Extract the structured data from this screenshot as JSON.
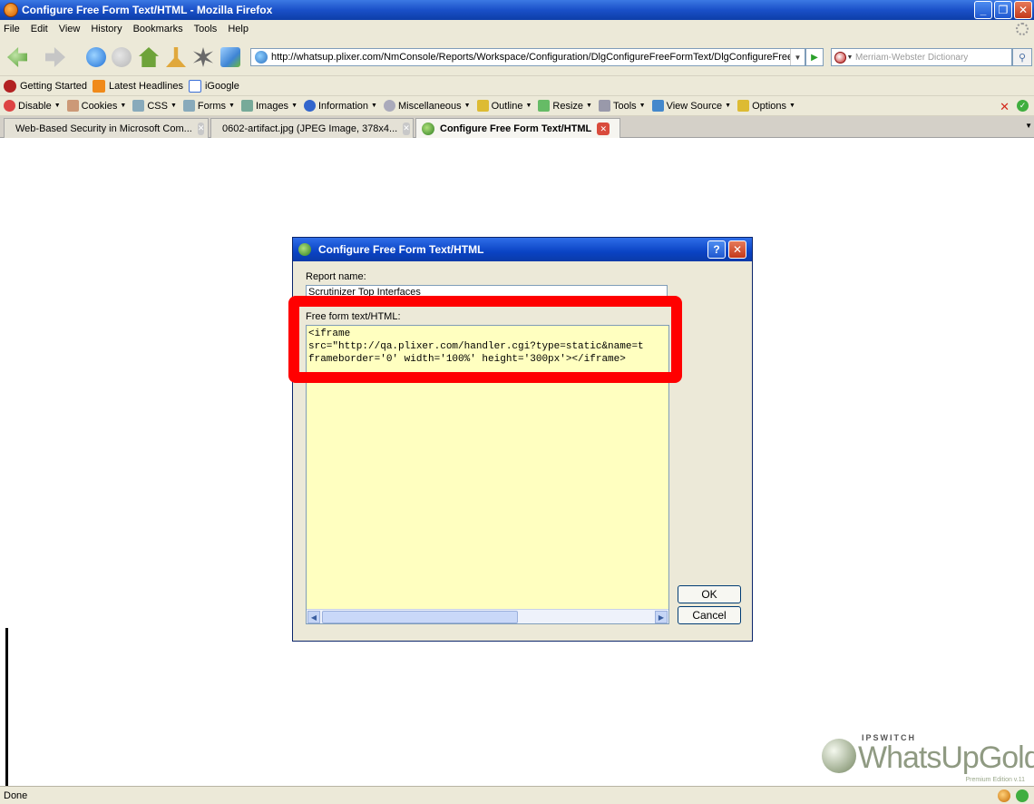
{
  "window": {
    "title": "Configure Free Form Text/HTML - Mozilla Firefox",
    "min": "_",
    "max": "❐",
    "close": "✕"
  },
  "menu": [
    "File",
    "Edit",
    "View",
    "History",
    "Bookmarks",
    "Tools",
    "Help"
  ],
  "nav": {
    "url": "http://whatsup.plixer.com/NmConsole/Reports/Workspace/Configuration/DlgConfigureFreeFormText/DlgConfigureFreeFormText.asp:",
    "search_placeholder": "Merriam-Webster Dictionary"
  },
  "bookmarks": [
    {
      "label": "Getting Started",
      "color": "#b22222"
    },
    {
      "label": "Latest Headlines",
      "color": "#f08a1a"
    },
    {
      "label": "iGoogle",
      "color": "#3b6fd8"
    }
  ],
  "devbar": [
    {
      "label": "Disable",
      "color": "#d44"
    },
    {
      "label": "Cookies",
      "color": "#c97"
    },
    {
      "label": "CSS",
      "color": "#8ab"
    },
    {
      "label": "Forms",
      "color": "#8ab"
    },
    {
      "label": "Images",
      "color": "#7a9"
    },
    {
      "label": "Information",
      "color": "#36c"
    },
    {
      "label": "Miscellaneous",
      "color": "#aab"
    },
    {
      "label": "Outline",
      "color": "#db3"
    },
    {
      "label": "Resize",
      "color": "#6b6"
    },
    {
      "label": "Tools",
      "color": "#99a"
    },
    {
      "label": "View Source",
      "color": "#48c"
    },
    {
      "label": "Options",
      "color": "#db3"
    }
  ],
  "tabs": [
    {
      "label": "Web-Based Security in Microsoft Com...",
      "active": false
    },
    {
      "label": "0602-artifact.jpg (JPEG Image, 378x4...",
      "active": false
    },
    {
      "label": "Configure Free Form Text/HTML",
      "active": true
    }
  ],
  "dialog": {
    "title": "Configure Free Form Text/HTML",
    "help": "?",
    "close": "✕",
    "report_name_label": "Report name:",
    "report_name_value": "Scrutinizer Top Interfaces",
    "freeform_label": "Free form text/HTML:",
    "freeform_value": "<iframe\nsrc=\"http://qa.plixer.com/handler.cgi?type=static&name=t\nframeborder='0' width='100%' height='300px'></iframe>",
    "ok": "OK",
    "cancel": "Cancel"
  },
  "brand": {
    "small": "IPSWITCH",
    "big": "WhatsUpGold",
    "edition": "Premium Edition v.11"
  },
  "status": "Done"
}
